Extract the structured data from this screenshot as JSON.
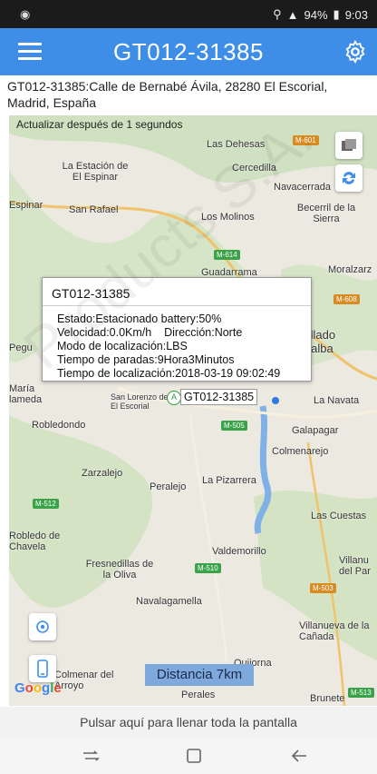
{
  "status_bar": {
    "left_icon": "app-notification-icon",
    "battery": "94%",
    "time": "9:03"
  },
  "app_bar": {
    "title": "GT012-31385",
    "menu_icon": "hamburger-menu-icon",
    "settings_icon": "gear-icon"
  },
  "address": "GT012-31385:Calle de Bernabé Ávila, 28280 El Escorial, Madrid, España",
  "update_text": "Actualizar después de 1 segundos",
  "map": {
    "places": [
      "Las Dehesas",
      "La Estación de El Espinar",
      "Cercedilla",
      "Navacerrada",
      "Espinar",
      "San Rafael",
      "Los Molinos",
      "Becerril de la Sierra",
      "Guadarrama",
      "Moralzarz",
      "Collado Villalba",
      "Pegu",
      "María lameda",
      "San Lorenzo de El Escorial",
      "La Navata",
      "Robledondo",
      "Galapagar",
      "Colmenarejo",
      "Zarzalejo",
      "La Pizarrera",
      "Peralejo",
      "Las Cuestas",
      "Robledo de Chavela",
      "Valdemorillo",
      "Fresnedillas de la Oliva",
      "Villanu del Par",
      "Navalagamella",
      "Villanueva de la Cañada",
      "Colmenar del Arroyo",
      "Quijorna",
      "Perales",
      "Brunete"
    ],
    "road_badges": [
      "M-601",
      "M-614",
      "M-608",
      "M-505",
      "M-512",
      "M-510",
      "M-503",
      "M-513"
    ],
    "layers_button_icon": "layers-icon",
    "refresh_button_icon": "refresh-icon",
    "locate_button_icon": "locate-target-icon",
    "phone_button_icon": "phone-icon",
    "distance": "Distancia 7km",
    "google_logo": "Google"
  },
  "info_window": {
    "title": "GT012-31385",
    "lines": [
      "Estado:Estacionado battery:50%",
      "Velocidad:0.0Km/h    Dirección:Norte",
      "Modo de localización:LBS",
      "Tiempo de paradas:9Hora3Minutos",
      "Tiempo de localización:2018-03-19 09:02:49"
    ]
  },
  "marker": {
    "label": "GT012-31385",
    "origin_letter": "A"
  },
  "fullscreen_text": "Pulsar aquí para llenar toda la pantalla",
  "nav_bar": {
    "recent_icon": "recent-apps-icon",
    "home_icon": "home-icon",
    "back_icon": "back-arrow-icon"
  },
  "watermark_text": "Products S.A."
}
